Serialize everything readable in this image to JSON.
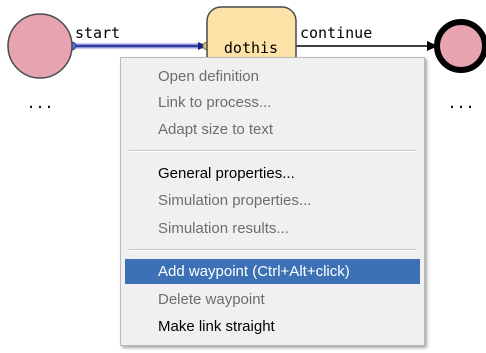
{
  "diagram": {
    "link_start_label": "start",
    "link_continue_label": "continue",
    "task_label": "dothis",
    "start_ellipsis": "...",
    "end_ellipsis": "...",
    "colors": {
      "state_fill": "#e8a3b1",
      "task_fill": "#fde3a7",
      "selected_link": "#3b4dbf"
    }
  },
  "context_menu": {
    "items": [
      {
        "label": "Open definition",
        "enabled": false
      },
      {
        "label": "Link to process...",
        "enabled": false
      },
      {
        "label": "Adapt size to text",
        "enabled": false
      },
      {
        "label": "General properties...",
        "enabled": true
      },
      {
        "label": "Simulation properties...",
        "enabled": false
      },
      {
        "label": "Simulation results...",
        "enabled": false
      },
      {
        "label": "Add waypoint (Ctrl+Alt+click)",
        "enabled": true,
        "highlighted": true
      },
      {
        "label": "Delete waypoint",
        "enabled": false
      },
      {
        "label": "Make link straight",
        "enabled": true
      }
    ],
    "highlight_color": "#3c71b6"
  }
}
